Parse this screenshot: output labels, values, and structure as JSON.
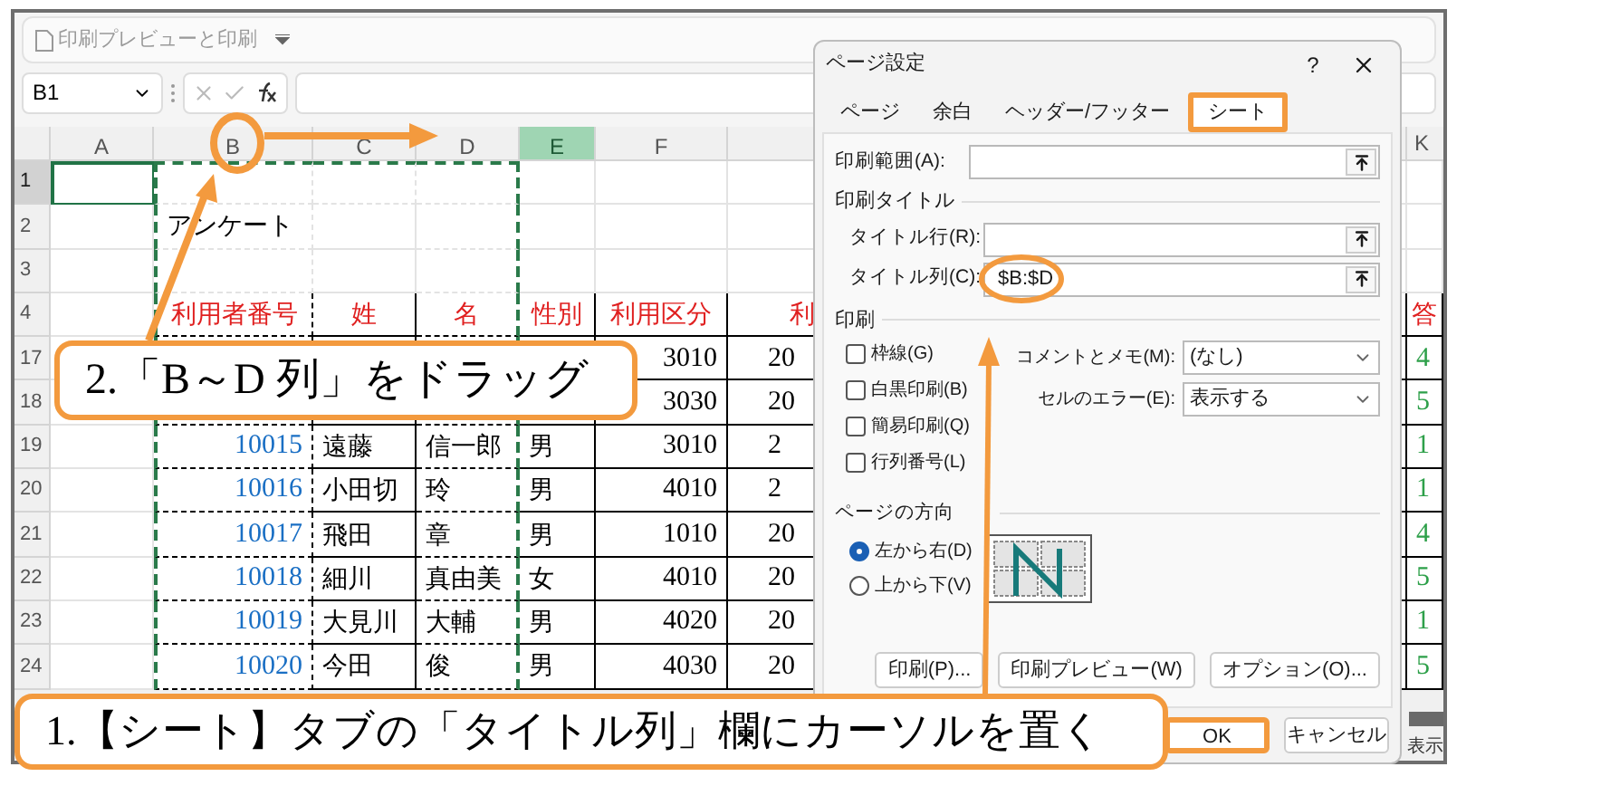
{
  "quick_access": {
    "label": "印刷プレビューと印刷"
  },
  "formula_bar": {
    "name_box": "B1"
  },
  "sheet": {
    "columns": [
      {
        "label": "A",
        "selected": false
      },
      {
        "label": "B",
        "selected": false
      },
      {
        "label": "C",
        "selected": false
      },
      {
        "label": "D",
        "selected": false
      },
      {
        "label": "E",
        "selected": true
      },
      {
        "label": "F",
        "selected": false
      }
    ],
    "last_column": {
      "label": "K"
    },
    "rows": [
      {
        "number": "1",
        "selected": true,
        "kind": "blank"
      },
      {
        "number": "2",
        "selected": false,
        "kind": "blank",
        "b": "アンケート"
      },
      {
        "number": "3",
        "selected": false,
        "kind": "blank"
      },
      {
        "number": "4",
        "selected": false,
        "kind": "header",
        "b": "利用者番号",
        "c": "姓",
        "d": "名",
        "e": "性別",
        "f": "利用区分",
        "g": "利",
        "k": "答"
      },
      {
        "number": "17",
        "selected": false,
        "kind": "data",
        "f": "3010",
        "g": "20",
        "k": "4"
      },
      {
        "number": "18",
        "selected": false,
        "kind": "data",
        "f": "3030",
        "g": "20",
        "k": "5"
      },
      {
        "number": "19",
        "selected": false,
        "kind": "data",
        "b": "10015",
        "c": "遠藤",
        "d": "信一郎",
        "e": "男",
        "f": "3010",
        "g": "2",
        "k": "1"
      },
      {
        "number": "20",
        "selected": false,
        "kind": "data",
        "b": "10016",
        "c": "小田切",
        "d": "玲",
        "e": "男",
        "f": "4010",
        "g": "2",
        "k": "1"
      },
      {
        "number": "21",
        "selected": false,
        "kind": "data",
        "b": "10017",
        "c": "飛田",
        "d": "章",
        "e": "男",
        "f": "1010",
        "g": "20",
        "k": "4"
      },
      {
        "number": "22",
        "selected": false,
        "kind": "data",
        "b": "10018",
        "c": "細川",
        "d": "真由美",
        "e": "女",
        "f": "4010",
        "g": "20",
        "k": "5"
      },
      {
        "number": "23",
        "selected": false,
        "kind": "data",
        "b": "10019",
        "c": "大見川",
        "d": "大輔",
        "e": "男",
        "f": "4020",
        "g": "20",
        "k": "1"
      },
      {
        "number": "24",
        "selected": false,
        "kind": "data",
        "b": "10020",
        "c": "今田",
        "d": "俊",
        "e": "男",
        "f": "4030",
        "g": "20",
        "k": "5"
      }
    ]
  },
  "status_bar": {
    "text": "表示"
  },
  "dialog": {
    "title": "ページ設定",
    "help": "?",
    "tabs": [
      {
        "label": "ページ",
        "selected": false
      },
      {
        "label": "余白",
        "selected": false
      },
      {
        "label": "ヘッダー/フッター",
        "selected": false
      },
      {
        "label": "シート",
        "selected": true
      }
    ],
    "print_area": {
      "label": "印刷範囲(A):"
    },
    "print_titles": {
      "heading": "印刷タイトル",
      "rows_label": "タイトル行(R):",
      "columns_label": "タイトル列(C):",
      "columns_value": "$B:$D"
    },
    "print": {
      "heading": "印刷",
      "checkboxes": [
        {
          "label": "枠線(G)",
          "checked": false
        },
        {
          "label": "白黒印刷(B)",
          "checked": false
        },
        {
          "label": "簡易印刷(Q)",
          "checked": false
        },
        {
          "label": "行列番号(L)",
          "checked": false
        }
      ],
      "selects": [
        {
          "label": "コメントとメモ(M):",
          "value": "(なし)"
        },
        {
          "label": "セルのエラー(E):",
          "value": "表示する"
        }
      ]
    },
    "page_order": {
      "heading": "ページの方向",
      "radios": [
        {
          "label": "左から右(D)",
          "selected": true
        },
        {
          "label": "上から下(V)",
          "selected": false
        }
      ]
    },
    "buttons": [
      "印刷(P)...",
      "印刷プレビュー(W)",
      "オプション(O)..."
    ],
    "footer_buttons": [
      {
        "label": "OK",
        "highlighted": true
      },
      {
        "label": "キャンセル",
        "highlighted": false
      }
    ]
  },
  "callouts": [
    {
      "text": "2.「B～D 列」をドラッグ"
    },
    {
      "text": "1.【シート】タブの「タイトル列」欄にカーソルを置く"
    }
  ]
}
